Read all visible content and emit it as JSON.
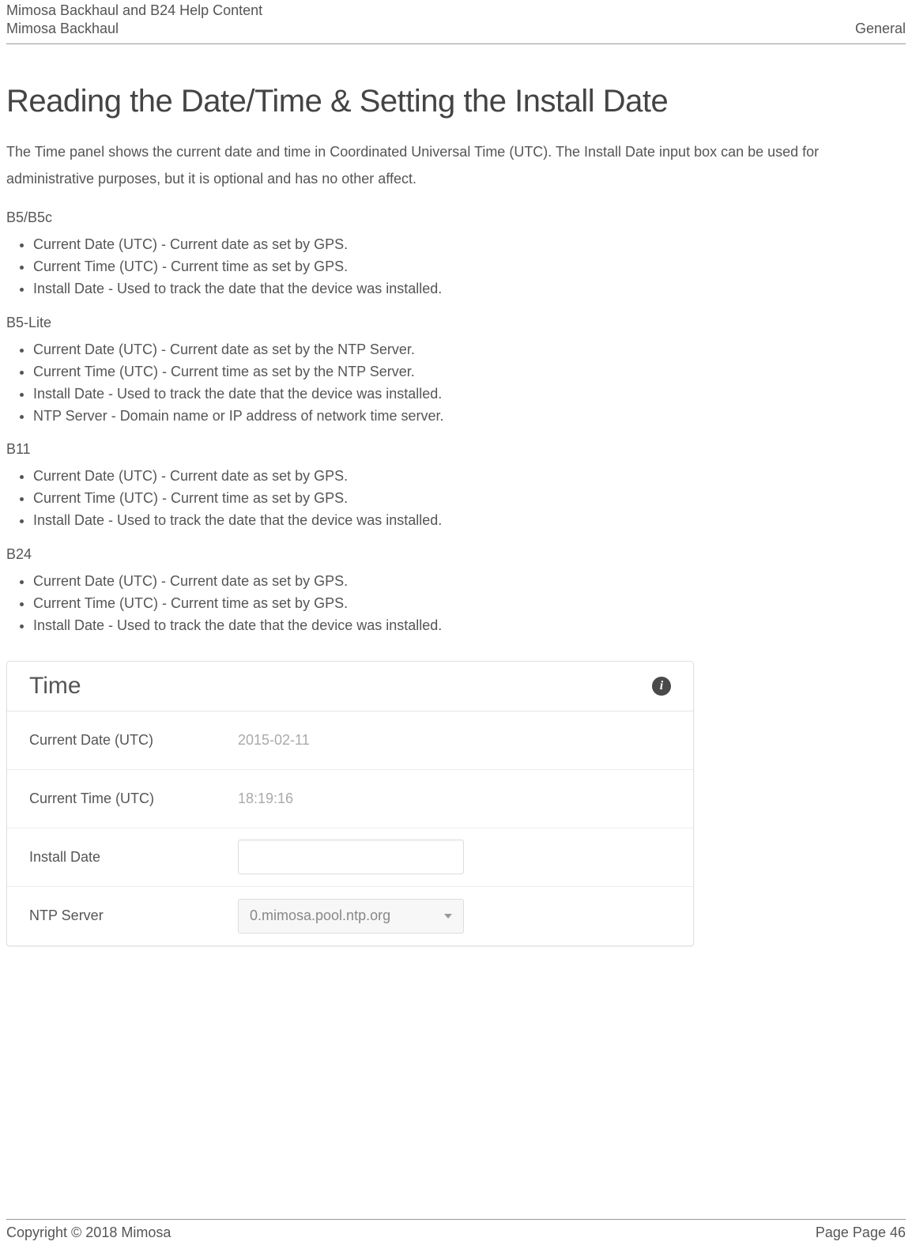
{
  "header": {
    "line1": "Mimosa Backhaul and B24 Help Content",
    "line2": "Mimosa Backhaul",
    "right": "General"
  },
  "title": "Reading the Date/Time & Setting the Install Date",
  "intro": "The Time panel shows the current date and time in Coordinated Universal Time (UTC). The Install Date input box can be used for administrative purposes, but it is optional and has no other affect.",
  "sections": [
    {
      "label": "B5/B5c",
      "items": [
        "Current Date (UTC) - Current date as set by GPS.",
        "Current Time (UTC) - Current time as set by GPS.",
        "Install Date - Used to track the date that the device was installed."
      ]
    },
    {
      "label": "B5-Lite",
      "items": [
        "Current Date (UTC) - Current date as set by the NTP Server.",
        "Current Time (UTC) - Current time as set by the NTP Server.",
        "Install Date - Used to track the date that the device was installed.",
        "NTP Server - Domain name or IP address of network time server."
      ]
    },
    {
      "label": "B11",
      "items": [
        "Current Date (UTC) - Current date as set by GPS.",
        "Current Time (UTC) - Current time as set by GPS.",
        "Install Date - Used to track the date that the device was installed."
      ]
    },
    {
      "label": "B24",
      "items": [
        "Current Date (UTC) - Current date as set by GPS.",
        "Current Time (UTC) - Current time as set by GPS.",
        "Install Date - Used to track the date that the device was installed."
      ]
    }
  ],
  "panel": {
    "title": "Time",
    "info_icon": "i",
    "rows": {
      "current_date": {
        "label": "Current Date (UTC)",
        "value": "2015-02-11"
      },
      "current_time": {
        "label": "Current Time (UTC)",
        "value": "18:19:16"
      },
      "install_date": {
        "label": "Install Date",
        "value": ""
      },
      "ntp_server": {
        "label": "NTP Server",
        "value": "0.mimosa.pool.ntp.org"
      }
    }
  },
  "footer": {
    "left": "Copyright © 2018 Mimosa",
    "right": "Page Page 46"
  }
}
